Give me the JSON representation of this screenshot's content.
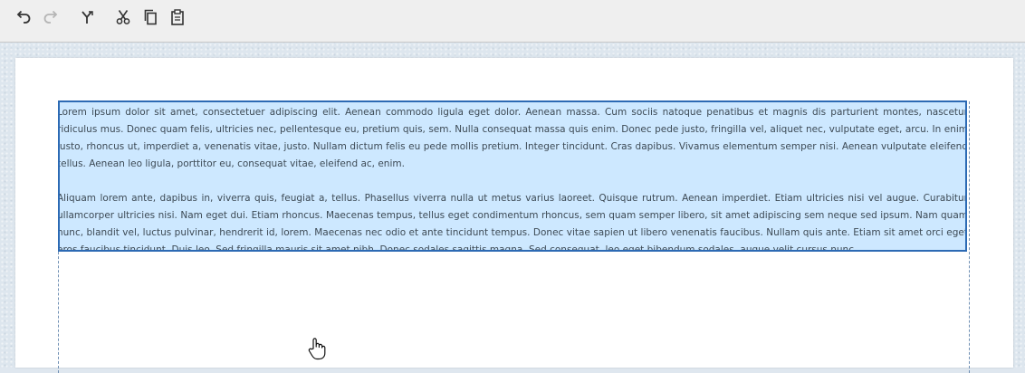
{
  "toolbar": {
    "buttons": [
      {
        "name": "undo-button",
        "icon": "undo-icon",
        "enabled": true
      },
      {
        "name": "redo-button",
        "icon": "redo-icon",
        "enabled": false
      },
      {
        "name": "merge-button",
        "icon": "merge-icon",
        "enabled": true
      },
      {
        "name": "cut-button",
        "icon": "scissors-icon",
        "enabled": true
      },
      {
        "name": "copy-button",
        "icon": "copy-icon",
        "enabled": true
      },
      {
        "name": "paste-button",
        "icon": "clipboard-icon",
        "enabled": true
      }
    ]
  },
  "editor": {
    "paragraph_1": "Lorem ipsum dolor sit amet, consectetuer adipiscing elit. Aenean commodo ligula eget dolor. Aenean massa. Cum sociis natoque penatibus et magnis dis parturient montes, nascetur ridiculus mus. Donec quam felis, ultricies nec, pellentesque eu, pretium quis, sem. Nulla consequat massa quis enim. Donec pede justo, fringilla vel, aliquet nec, vulputate eget, arcu. In enim justo, rhoncus ut, imperdiet a, venenatis vitae, justo. Nullam dictum felis eu pede mollis pretium. Integer tincidunt. Cras dapibus. Vivamus elementum semper nisi. Aenean vulputate eleifend tellus. Aenean leo ligula, porttitor eu, consequat vitae, eleifend ac, enim.",
    "paragraph_2": "Aliquam lorem ante, dapibus in, viverra quis, feugiat a, tellus. Phasellus viverra nulla ut metus varius laoreet. Quisque rutrum. Aenean imperdiet. Etiam ultricies nisi vel augue. Curabitur ullamcorper ultricies nisi. Nam eget dui. Etiam rhoncus. Maecenas tempus, tellus eget condimentum rhoncus, sem quam semper libero, sit amet adipiscing sem neque sed ipsum. Nam quam nunc, blandit vel, luctus pulvinar, hendrerit id, lorem. Maecenas nec odio et ante tincidunt tempus. Donec vitae sapien ut libero venenatis faucibus. Nullam quis ante. Etiam sit amet orci eget eros faucibus tincidunt. Duis leo. Sed fringilla mauris sit amet nibh. Donec sodales sagittis magna. Sed consequat, leo eget bibendum sodales, augue velit cursus nunc,"
  },
  "colors": {
    "selection_bg": "#cde8ff",
    "selection_border": "#2c6ab4",
    "text": "#3d4a55"
  }
}
